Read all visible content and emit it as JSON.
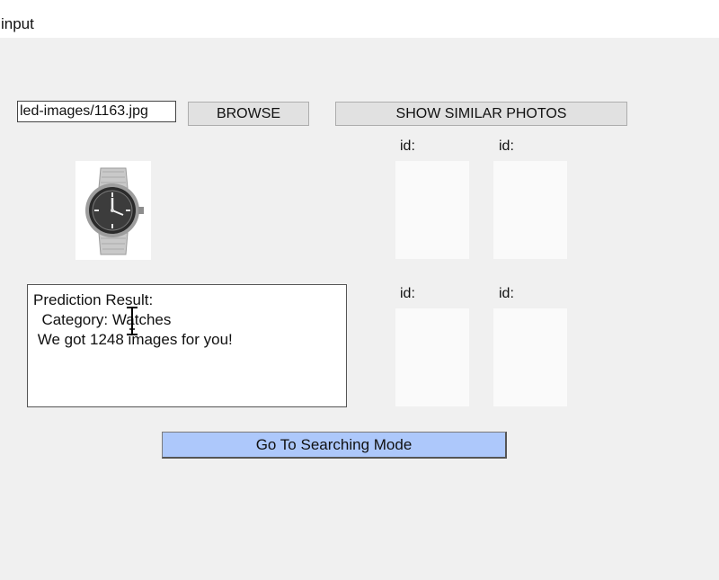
{
  "window": {
    "title": "input"
  },
  "file": {
    "path": "led-images/1163.jpg"
  },
  "buttons": {
    "browse": "BROWSE",
    "show_similar": "SHOW SIMILAR PHOTOS",
    "search_mode": "Go To Searching Mode"
  },
  "query_image": {
    "description_icon": "watch-image"
  },
  "prediction": {
    "line1": "Prediction Result:",
    "line2": "  Category: Watches",
    "line3": " We got 1248 images for you!"
  },
  "similar": {
    "slots": [
      {
        "label": "id:"
      },
      {
        "label": "id:"
      },
      {
        "label": "id:"
      },
      {
        "label": "id:"
      }
    ]
  },
  "colors": {
    "background": "#f0f0f0",
    "search_button": "#adc8fb",
    "button_face": "#e1e1e1"
  }
}
